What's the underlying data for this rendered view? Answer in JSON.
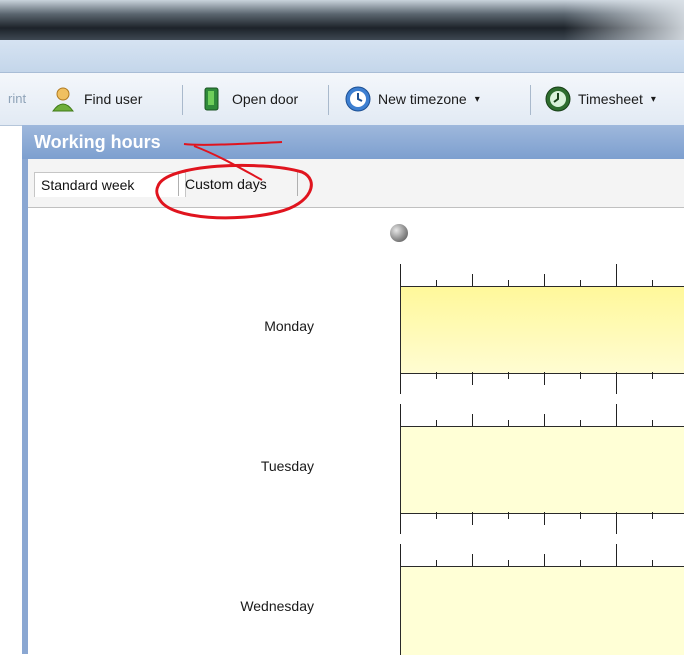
{
  "toolbar": {
    "prev_partial": "rint",
    "find_user": "Find user",
    "open_door": "Open door",
    "new_timezone": "New timezone",
    "timesheet": "Timesheet",
    "caret": "▾"
  },
  "panel": {
    "title": "Working hours",
    "tabs": {
      "standard": "Standard week",
      "custom": "Custom days"
    }
  },
  "days": [
    "Monday",
    "Tuesday",
    "Wednesday"
  ],
  "colors": {
    "header": "#7d9fcf",
    "monday_bar": "#fff89a",
    "day_bar": "#ffffd6",
    "annotation": "#e0141e"
  },
  "icons": {
    "find_user": "user-search-icon",
    "open_door": "door-icon",
    "new_timezone": "clock-icon",
    "timesheet": "timesheet-clock-icon"
  }
}
